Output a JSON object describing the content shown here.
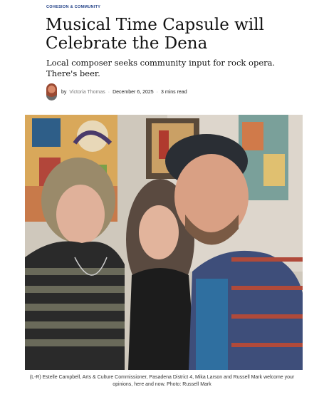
{
  "article": {
    "category": "Cohesion & Community",
    "headline": "Musical Time Capsule will Celebrate the Dena",
    "dek": "Local composer seeks community input for rock opera. There's beer.",
    "byline": {
      "prefix": "by",
      "author": "Victoria Thomas",
      "separator": "·",
      "date": "December 6, 2025",
      "separator2": "·",
      "read_time": "3 mins read"
    },
    "photo": {
      "caption": "(L-R) Estelle Campbell, Arts & Culture Commissioner, Pasadena District 4, Mika Larson and Russell Mark welcome your opinions, here and now. Photo: Russell Mark"
    }
  }
}
